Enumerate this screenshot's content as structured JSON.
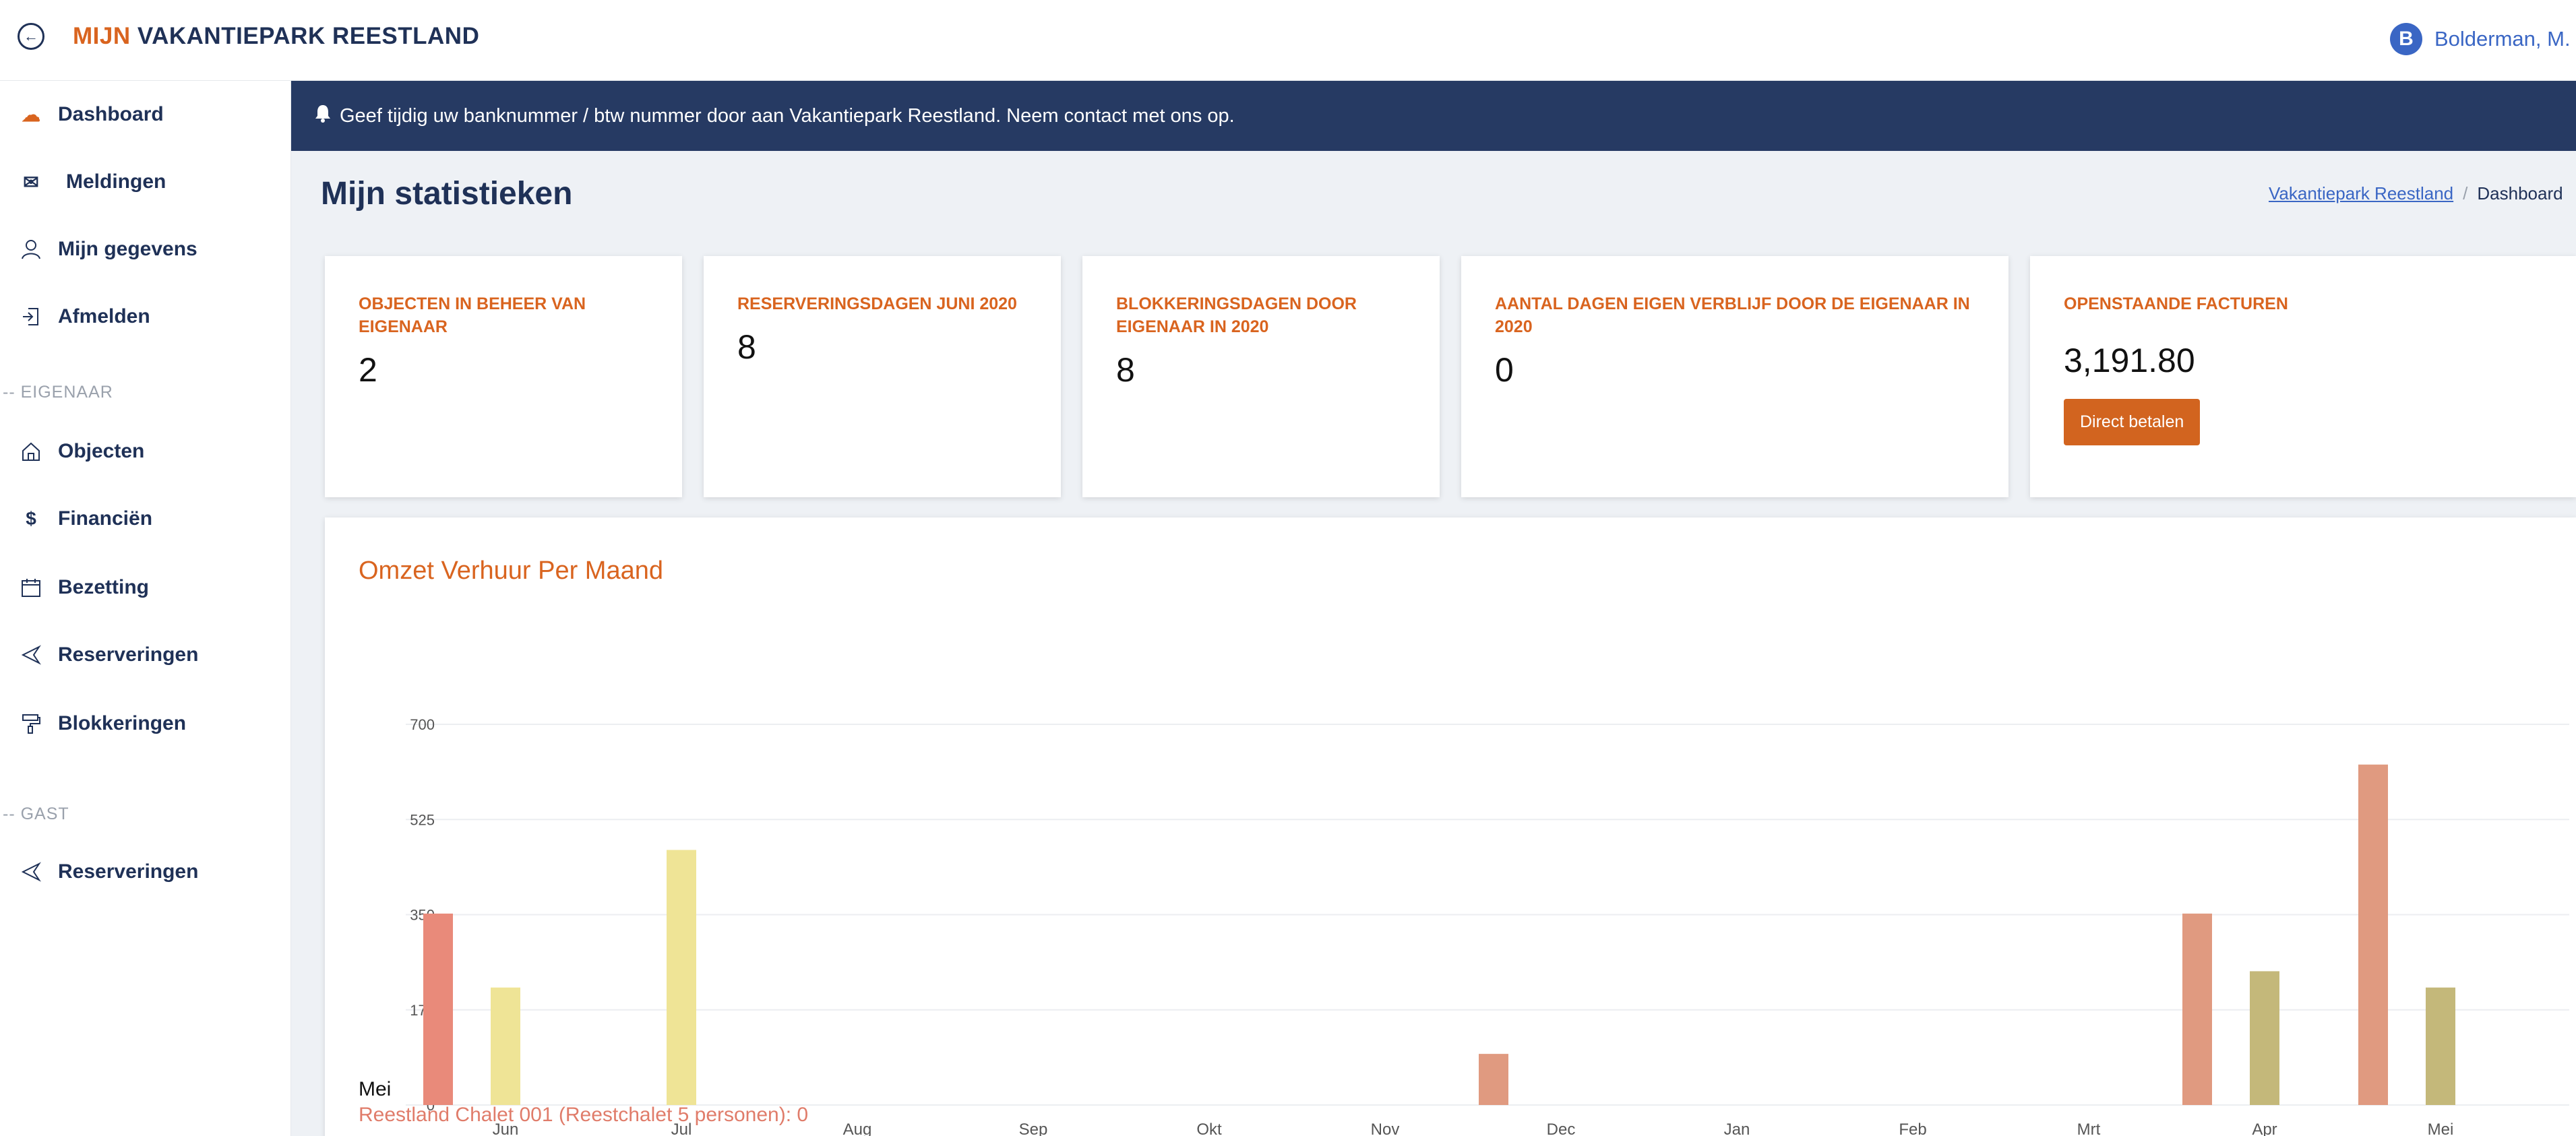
{
  "header": {
    "brand_accent": "MIJN",
    "brand_rest": "VAKANTIEPARK REESTLAND",
    "user_initial": "B",
    "user_name": "Bolderman, M."
  },
  "sidebar": {
    "items": [
      {
        "label": "Dashboard",
        "icon": "cloud-icon"
      },
      {
        "label": "Meldingen",
        "icon": "mail-icon"
      },
      {
        "label": "Mijn gegevens",
        "icon": "user-icon"
      },
      {
        "label": "Afmelden",
        "icon": "logout-icon"
      }
    ],
    "section_owner": "-- EIGENAAR",
    "owner_items": [
      {
        "label": "Objecten",
        "icon": "home-icon"
      },
      {
        "label": "Financiën",
        "icon": "dollar-icon"
      },
      {
        "label": "Bezetting",
        "icon": "calendar-icon"
      },
      {
        "label": "Reserveringen",
        "icon": "send-icon"
      },
      {
        "label": "Blokkeringen",
        "icon": "paint-roller-icon"
      }
    ],
    "section_guest": "-- GAST",
    "guest_items": [
      {
        "label": "Reserveringen",
        "icon": "send-icon"
      }
    ]
  },
  "banner": {
    "icon": "bell-icon",
    "text": "Geef tijdig uw banknummer / btw nummer door aan Vakantiepark Reestland. Neem contact met ons op."
  },
  "page": {
    "title": "Mijn statistieken",
    "breadcrumb_link": "Vakantiepark Reestland",
    "breadcrumb_sep": "/",
    "breadcrumb_current": "Dashboard"
  },
  "cards": [
    {
      "title": "OBJECTEN IN BEHEER VAN EIGENAAR",
      "value": "2"
    },
    {
      "title": "RESERVERINGSDAGEN JUNI 2020",
      "value": "8"
    },
    {
      "title": "BLOKKERINGSDAGEN DOOR EIGENAAR IN 2020",
      "value": "8"
    },
    {
      "title": "AANTAL DAGEN EIGEN VERBLIJF DOOR DE EIGENAAR IN 2020",
      "value": "0"
    },
    {
      "title": "OPENSTAANDE FACTUREN",
      "value": "3,191.80",
      "button": "Direct betalen"
    }
  ],
  "chart_data": {
    "type": "bar",
    "title": "Omzet Verhuur Per Maand",
    "categories": [
      "Jun",
      "Jul",
      "Aug",
      "Sep",
      "Okt",
      "Nov",
      "Dec",
      "Jan",
      "Feb",
      "Mrt",
      "Apr",
      "Mei"
    ],
    "yticks": [
      0,
      175,
      350,
      525,
      700
    ],
    "ylim": [
      0,
      700
    ],
    "grid": true,
    "colors": [
      "#e98a7a",
      "#efe496",
      "#e09a80",
      "#c4b87a"
    ],
    "series": [
      {
        "values": [
          352,
          0,
          0,
          0,
          0,
          0,
          0,
          0,
          0,
          0,
          0,
          0
        ],
        "color": "#e98a7a"
      },
      {
        "values": [
          216,
          469,
          0,
          0,
          0,
          0,
          0,
          0,
          0,
          0,
          0,
          0
        ],
        "color": "#efe496"
      },
      {
        "values": [
          0,
          0,
          0,
          0,
          0,
          0,
          94,
          0,
          0,
          0,
          352,
          626
        ],
        "color": "#e09a80"
      },
      {
        "values": [
          0,
          0,
          0,
          0,
          0,
          0,
          0,
          0,
          0,
          0,
          246,
          216
        ],
        "color": "#c4b87a"
      }
    ],
    "tooltip_month": "Mei",
    "tooltip_line": "Reestland Chalet 001 (Reestchalet 5 personen): 0"
  }
}
